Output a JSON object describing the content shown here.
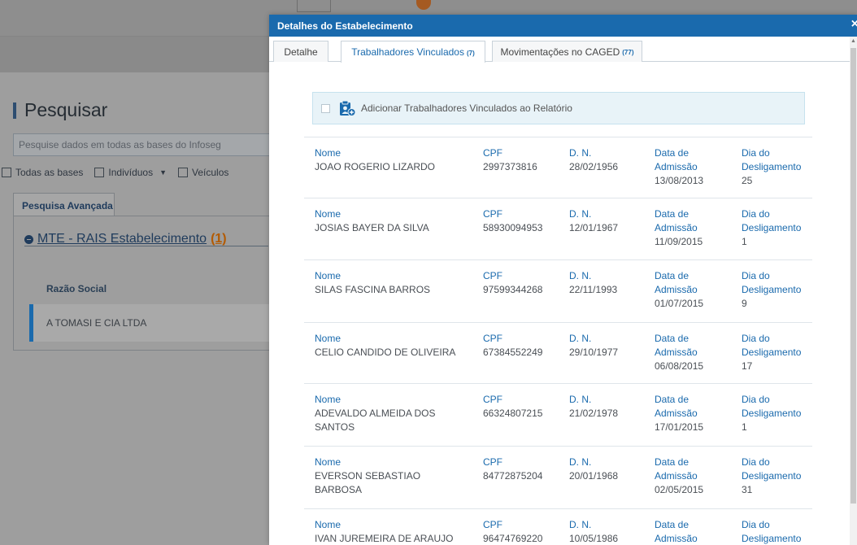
{
  "background": {
    "title": "Pesquisar",
    "search_placeholder": "Pesquise dados em todas as bases do Infoseg",
    "checks": [
      "Todas as bases",
      "Indivíduos",
      "Veículos"
    ],
    "tab": "Pesquisa Avançada",
    "section_title": "MTE - RAIS Estabelecimento",
    "section_count": "(1)",
    "column_header": "Razão Social",
    "result": "A TOMASI E CIA LTDA"
  },
  "modal": {
    "title": "Detalhes do Estabelecimento",
    "close": "×",
    "tabs": [
      {
        "label": "Detalhe",
        "count": ""
      },
      {
        "label": "Trabalhadores Vinculados",
        "count": "(7)"
      },
      {
        "label": "Movimentações no CAGED",
        "count": "(77)"
      }
    ],
    "add_label": "Adicionar Trabalhadores Vinculados ao Relatório",
    "labels": {
      "nome": "Nome",
      "cpf": "CPF",
      "dn": "D. N.",
      "adm": "Data de Admissão",
      "desl": "Dia do Desligamento"
    },
    "rows": [
      {
        "nome": "JOAO ROGERIO LIZARDO",
        "cpf": "2997373816",
        "dn": "28/02/1956",
        "adm": "13/08/2013",
        "desl": "25"
      },
      {
        "nome": "JOSIAS BAYER DA SILVA",
        "cpf": "58930094953",
        "dn": "12/01/1967",
        "adm": "11/09/2015",
        "desl": "1"
      },
      {
        "nome": "SILAS FASCINA BARROS",
        "cpf": "97599344268",
        "dn": "22/11/1993",
        "adm": "01/07/2015",
        "desl": "9"
      },
      {
        "nome": "CELIO CANDIDO DE OLIVEIRA",
        "cpf": "67384552249",
        "dn": "29/10/1977",
        "adm": "06/08/2015",
        "desl": "17"
      },
      {
        "nome": "ADEVALDO ALMEIDA DOS SANTOS",
        "cpf": "66324807215",
        "dn": "21/02/1978",
        "adm": "17/01/2015",
        "desl": "1"
      },
      {
        "nome": "EVERSON SEBASTIAO BARBOSA",
        "cpf": "84772875204",
        "dn": "20/01/1968",
        "adm": "02/05/2015",
        "desl": "31"
      },
      {
        "nome": "IVAN JUREMEIRA DE ARAUJO",
        "cpf": "96474769220",
        "dn": "10/05/1986",
        "adm": "",
        "desl": ""
      }
    ]
  },
  "colors": {
    "accent": "#1a6aad",
    "count_orange": "#b35a00"
  }
}
